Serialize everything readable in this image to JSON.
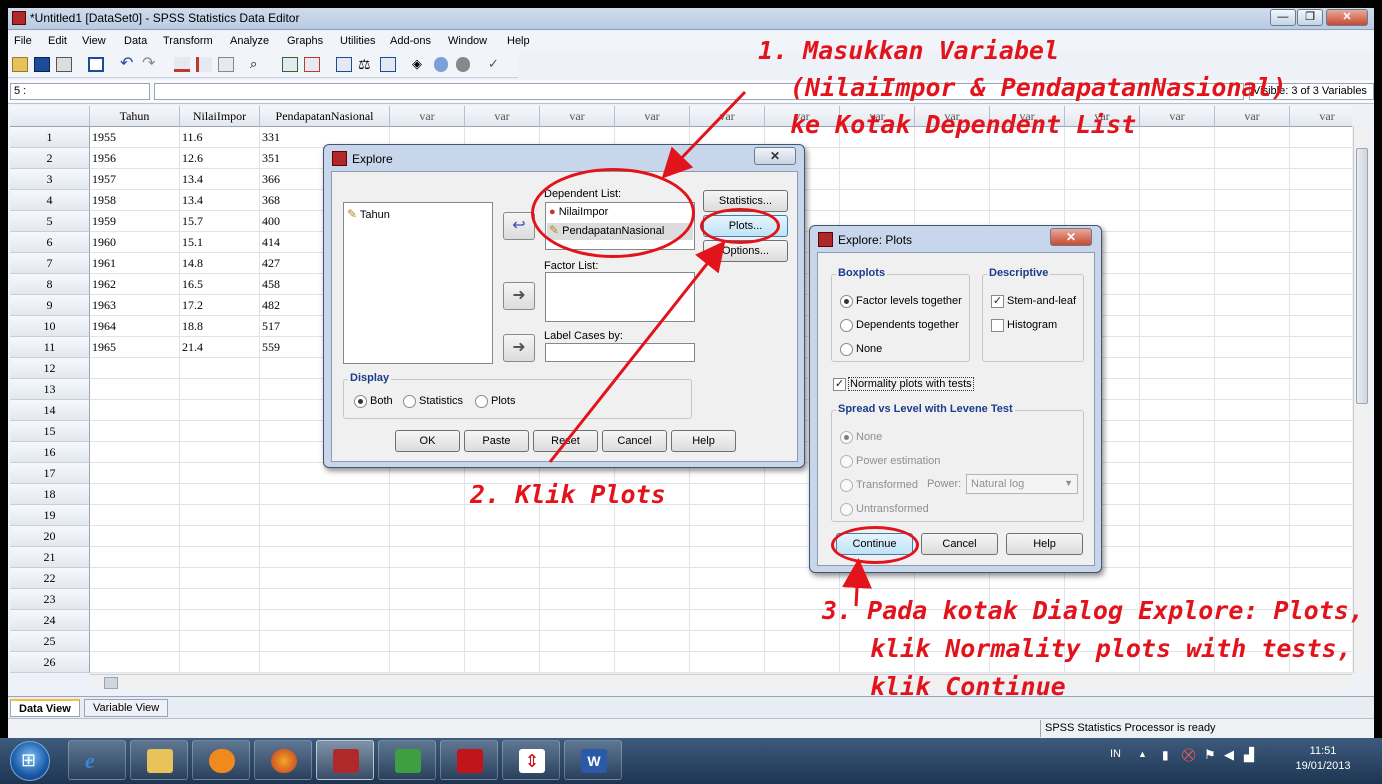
{
  "window": {
    "title": "*Untitled1 [DataSet0] - SPSS Statistics Data Editor",
    "controls": [
      "—",
      "❐",
      "✕"
    ]
  },
  "menu": [
    "File",
    "Edit",
    "View",
    "Data",
    "Transform",
    "Analyze",
    "Graphs",
    "Utilities",
    "Add-ons",
    "Window",
    "Help"
  ],
  "cellbar": {
    "ref": "5 :",
    "value": "",
    "visible": "Visible: 3 of 3 Variables"
  },
  "grid": {
    "columns": [
      "Tahun",
      "NilaiImpor",
      "PendapatanNasional",
      "var",
      "var",
      "var",
      "var",
      "var",
      "var",
      "var",
      "var",
      "var",
      "var",
      "var",
      "var",
      "var",
      "var"
    ],
    "rows": [
      [
        "1",
        "1955",
        "11.6",
        "331"
      ],
      [
        "2",
        "1956",
        "12.6",
        "351"
      ],
      [
        "3",
        "1957",
        "13.4",
        "366"
      ],
      [
        "4",
        "1958",
        "13.4",
        "368"
      ],
      [
        "5",
        "1959",
        "15.7",
        "400"
      ],
      [
        "6",
        "1960",
        "15.1",
        "414"
      ],
      [
        "7",
        "1961",
        "14.8",
        "427"
      ],
      [
        "8",
        "1962",
        "16.5",
        "458"
      ],
      [
        "9",
        "1963",
        "17.2",
        "482"
      ],
      [
        "10",
        "1964",
        "18.8",
        "517"
      ],
      [
        "11",
        "1965",
        "21.4",
        "559"
      ],
      [
        "12",
        "",
        "",
        ""
      ],
      [
        "13",
        "",
        "",
        ""
      ],
      [
        "14",
        "",
        "",
        ""
      ],
      [
        "15",
        "",
        "",
        ""
      ],
      [
        "16",
        "",
        "",
        ""
      ],
      [
        "17",
        "",
        "",
        ""
      ],
      [
        "18",
        "",
        "",
        ""
      ],
      [
        "19",
        "",
        "",
        ""
      ],
      [
        "20",
        "",
        "",
        ""
      ],
      [
        "21",
        "",
        "",
        ""
      ],
      [
        "22",
        "",
        "",
        ""
      ],
      [
        "23",
        "",
        "",
        ""
      ],
      [
        "24",
        "",
        "",
        ""
      ],
      [
        "25",
        "",
        "",
        ""
      ],
      [
        "26",
        "",
        "",
        ""
      ]
    ]
  },
  "tabs": {
    "data_view": "Data View",
    "variable_view": "Variable View"
  },
  "status": "SPSS Statistics  Processor is ready",
  "explore": {
    "title": "Explore",
    "close": "✕",
    "source_var": "Tahun",
    "dependent_label": "Dependent List:",
    "dependent_items": [
      "NilaiImpor",
      "PendapatanNasional"
    ],
    "factor_label": "Factor List:",
    "labelcases_label": "Label Cases by:",
    "side_buttons": [
      "Statistics...",
      "Plots...",
      "Options..."
    ],
    "display_label": "Display",
    "display_options": [
      "Both",
      "Statistics",
      "Plots"
    ],
    "display_selected": "Both",
    "bottom_buttons": [
      "OK",
      "Paste",
      "Reset",
      "Cancel",
      "Help"
    ]
  },
  "plots": {
    "title": "Explore: Plots",
    "close": "✕",
    "boxplots_label": "Boxplots",
    "boxplots_options": [
      "Factor levels together",
      "Dependents together",
      "None"
    ],
    "descriptive_label": "Descriptive",
    "stem_leaf": "Stem-and-leaf",
    "histogram": "Histogram",
    "normality": "Normality plots with tests",
    "spread_label": "Spread vs Level with Levene Test",
    "spread_options": [
      "None",
      "Power estimation",
      "Transformed",
      "Untransformed"
    ],
    "power_label": "Power:",
    "power_value": "Natural log",
    "buttons": [
      "Continue",
      "Cancel",
      "Help"
    ]
  },
  "annotations": {
    "step1_line1": "1. Masukkan Variabel",
    "step1_line2": "(NilaiImpor & PendapatanNasional)",
    "step1_line3": "ke Kotak Dependent List",
    "step2": "2. Klik Plots",
    "step3_line1": "3. Pada kotak Dialog Explore: Plots,",
    "step3_line2": "klik Normality plots with tests,",
    "step3_line3": "klik Continue",
    "color": "#e3131b"
  },
  "taskbar": {
    "lang": "IN",
    "time": "11:51",
    "date": "19/01/2013"
  }
}
